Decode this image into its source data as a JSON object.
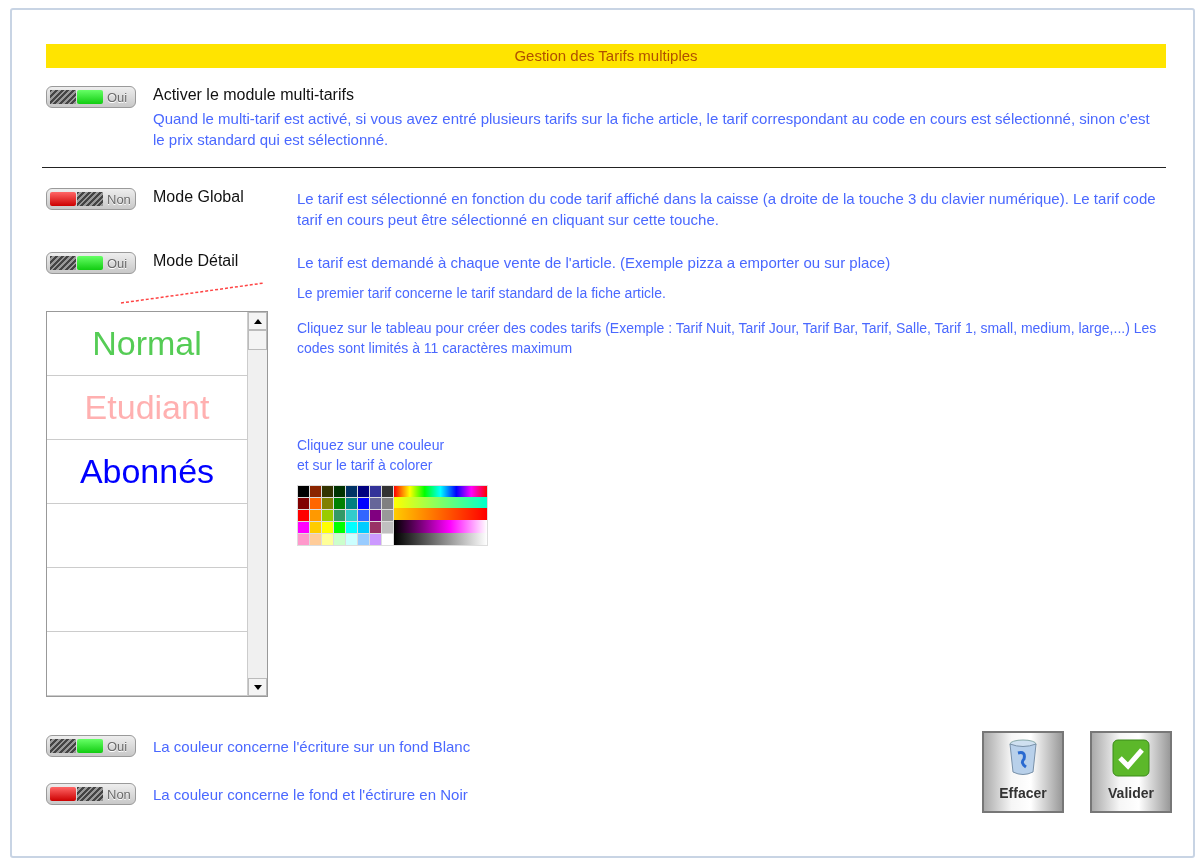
{
  "title": "Gestion des Tarifs multiples",
  "module": {
    "toggle": {
      "on": true,
      "text": "Oui"
    },
    "label": "Activer le module multi-tarifs",
    "description": "Quand le multi-tarif est activé, si vous avez entré plusieurs tarifs sur la fiche article, le tarif correspondant au code en cours est sélectionné, sinon c'est le prix standard qui est sélectionné."
  },
  "modes": [
    {
      "toggle": {
        "on": false,
        "text": "Non"
      },
      "label": "Mode Global",
      "description": "Le tarif est sélectionné en fonction du code tarif affiché dans la caisse (a droite de la touche 3 du clavier numérique). Le tarif code tarif en cours peut être sélectionné en cliquant sur cette touche."
    },
    {
      "toggle": {
        "on": true,
        "text": "Oui"
      },
      "label": "Mode Détail",
      "description": "Le tarif est demandé à chaque vente de l'article. (Exemple pizza a emporter ou sur place)"
    }
  ],
  "tariff_note": "Le premier tarif concerne le tarif standard de la fiche article.",
  "tariffs": [
    {
      "label": "Normal",
      "color": "#55cc55"
    },
    {
      "label": "Etudiant",
      "color": "#ffb0b0"
    },
    {
      "label": "Abonnés",
      "color": "#0000ff"
    }
  ],
  "tariff_help": "Cliquez sur le tableau pour créer des codes tarifs (Exemple : Tarif Nuit, Tarif Jour, Tarif Bar, Tarif, Salle, Tarif 1, small, medium, large,...)  Les codes sont limités à 11 caractères maximum",
  "color_help": [
    "Cliquez sur une couleur",
    "et sur le tarif à colorer"
  ],
  "color_options": [
    {
      "toggle": {
        "on": true,
        "text": "Oui"
      },
      "label": "La couleur concerne l'écriture sur un fond Blanc"
    },
    {
      "toggle": {
        "on": false,
        "text": "Non"
      },
      "label": "La couleur concerne le fond et l'éctirure en Noir"
    }
  ],
  "buttons": [
    {
      "kind": "clear",
      "label": "Effacer"
    },
    {
      "kind": "validate",
      "label": "Valider"
    }
  ]
}
